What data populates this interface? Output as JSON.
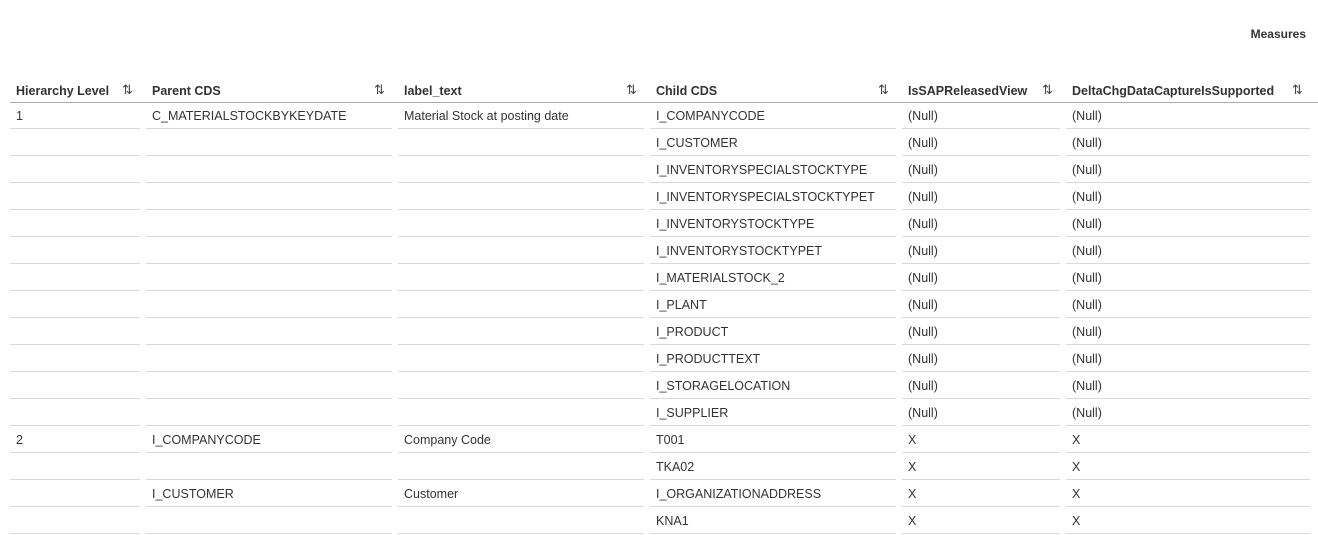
{
  "measures_label": "Measures",
  "columns": [
    {
      "label": "Hierarchy Level"
    },
    {
      "label": "Parent CDS"
    },
    {
      "label": "label_text"
    },
    {
      "label": "Child CDS"
    },
    {
      "label": "IsSAPReleasedView"
    },
    {
      "label": "DeltaChgDataCaptureIsSupported"
    }
  ],
  "sort_icon": "⇅",
  "rows": [
    [
      "1",
      "C_MATERIALSTOCKBYKEYDATE",
      "Material Stock at posting date",
      "I_COMPANYCODE",
      "(Null)",
      "(Null)"
    ],
    [
      "",
      "",
      "",
      "I_CUSTOMER",
      "(Null)",
      "(Null)"
    ],
    [
      "",
      "",
      "",
      "I_INVENTORYSPECIALSTOCKTYPE",
      "(Null)",
      "(Null)"
    ],
    [
      "",
      "",
      "",
      "I_INVENTORYSPECIALSTOCKTYPET",
      "(Null)",
      "(Null)"
    ],
    [
      "",
      "",
      "",
      "I_INVENTORYSTOCKTYPE",
      "(Null)",
      "(Null)"
    ],
    [
      "",
      "",
      "",
      "I_INVENTORYSTOCKTYPET",
      "(Null)",
      "(Null)"
    ],
    [
      "",
      "",
      "",
      "I_MATERIALSTOCK_2",
      "(Null)",
      "(Null)"
    ],
    [
      "",
      "",
      "",
      "I_PLANT",
      "(Null)",
      "(Null)"
    ],
    [
      "",
      "",
      "",
      "I_PRODUCT",
      "(Null)",
      "(Null)"
    ],
    [
      "",
      "",
      "",
      "I_PRODUCTTEXT",
      "(Null)",
      "(Null)"
    ],
    [
      "",
      "",
      "",
      "I_STORAGELOCATION",
      "(Null)",
      "(Null)"
    ],
    [
      "",
      "",
      "",
      "I_SUPPLIER",
      "(Null)",
      "(Null)"
    ],
    [
      "2",
      "I_COMPANYCODE",
      "Company Code",
      "T001",
      "X",
      "X"
    ],
    [
      "",
      "",
      "",
      "TKA02",
      "X",
      "X"
    ],
    [
      "",
      "I_CUSTOMER",
      "Customer",
      "I_ORGANIZATIONADDRESS",
      "X",
      "X"
    ],
    [
      "",
      "",
      "",
      "KNA1",
      "X",
      "X"
    ]
  ]
}
